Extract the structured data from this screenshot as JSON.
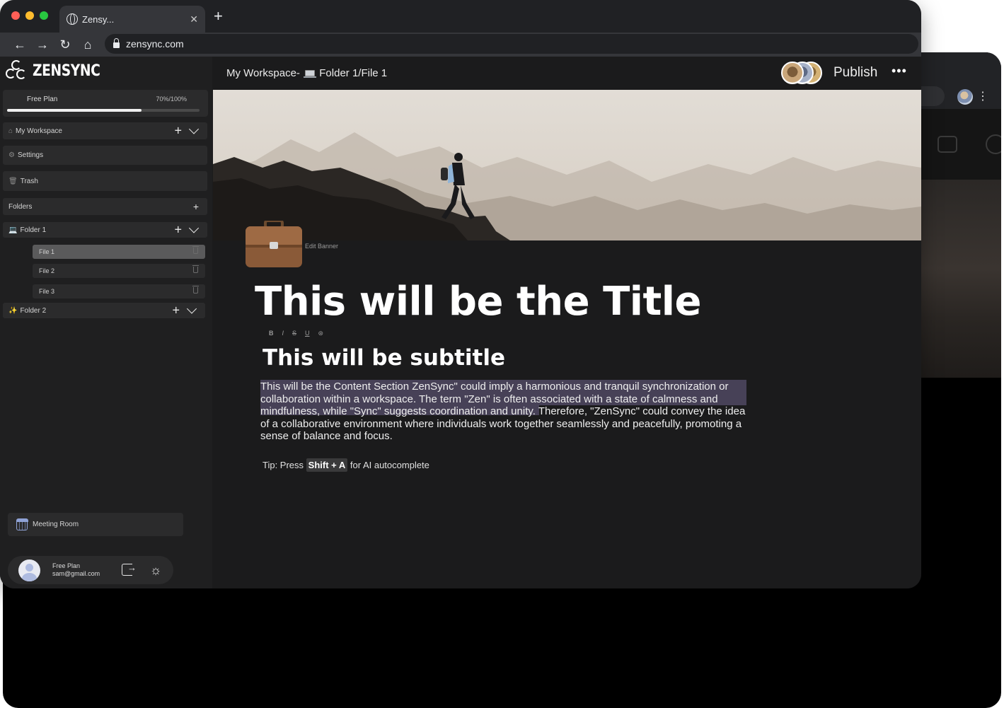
{
  "browser": {
    "tab_title": "Zensy...",
    "url": "zensync.com"
  },
  "app": {
    "logo_text": "ZENSYNC"
  },
  "sidebar": {
    "plan": {
      "label": "Free Plan",
      "usage": "70%/100%",
      "progress": 0.7
    },
    "workspace": {
      "label": "My Workspace"
    },
    "settings": {
      "label": "Settings"
    },
    "trash": {
      "label": "Trash"
    },
    "folders_header": {
      "label": "Folders"
    },
    "folders": [
      {
        "label": "Folder 1",
        "files": [
          "File 1",
          "File 2",
          "File 3"
        ]
      },
      {
        "label": "Folder 2"
      }
    ],
    "meeting_room": {
      "label": "Meeting Room"
    },
    "user": {
      "plan": "Free Plan",
      "email": "sam@gmail.com"
    }
  },
  "header": {
    "breadcrumb_prefix": "My Workspace-",
    "breadcrumb_path": "Folder 1/File 1",
    "publish_label": "Publish",
    "more_label": "•••"
  },
  "editor": {
    "edit_banner": "Edit Banner",
    "title": "This will be the Title",
    "format_tools": [
      "B",
      "I",
      "S",
      "U",
      "⊛"
    ],
    "subtitle": "This will be subtitle",
    "content": "This will be the Content Section ZenSync\" could imply a harmonious and tranquil synchronization or collaboration within a workspace. The  term \"Zen\" is often associated with a  state of calmness and mindfulness, while \"Sync\" suggests coordination and unity. Therefore, \"ZenSync\" could convey the idea of a collaborative environment where individuals work together seamlessly and peacefully, promoting a sense of balance and focus.",
    "tip_prefix": "Tip: Press",
    "tip_keys": "Shift + A",
    "tip_suffix": "for AI autocomplete"
  },
  "colors": {
    "background": "#1b1b1c",
    "sidebar_card": "#2b2b2c",
    "selection": "#474157",
    "accent_blue": "#8fa2d6"
  }
}
